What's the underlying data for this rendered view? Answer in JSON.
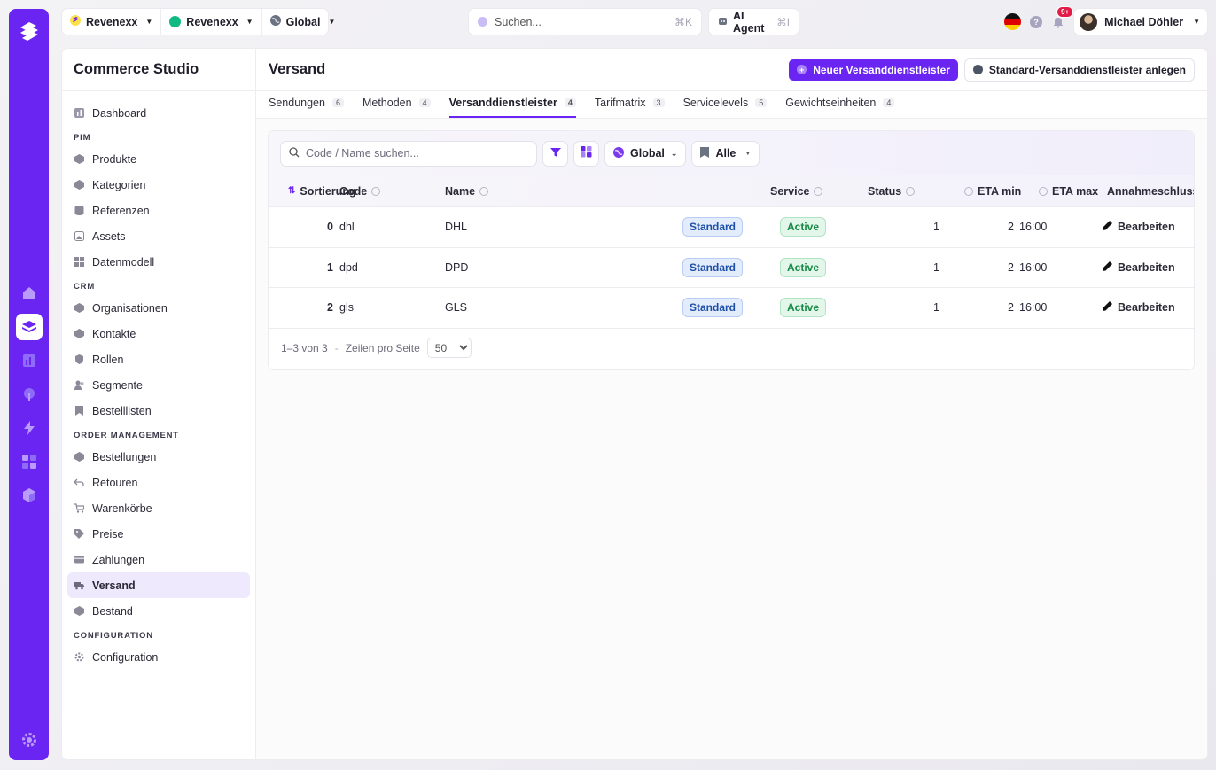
{
  "topbar": {
    "context": [
      {
        "label": "Revenexx",
        "icon": "revenexx-logo-icon"
      },
      {
        "label": "Revenexx",
        "icon": "green-dot-icon"
      },
      {
        "label": "Global",
        "icon": "globe-icon"
      }
    ],
    "search": {
      "placeholder": "Suchen...",
      "shortcut": "⌘K"
    },
    "agent": {
      "label": "AI Agent",
      "shortcut": "⌘I"
    },
    "notifications_badge": "9+",
    "user_name": "Michael Döhler"
  },
  "sidebar": {
    "app_title": "Commerce Studio",
    "top_items": [
      {
        "label": "Dashboard"
      }
    ],
    "sections": [
      {
        "title": "PIM",
        "items": [
          {
            "label": "Produkte"
          },
          {
            "label": "Kategorien"
          },
          {
            "label": "Referenzen"
          },
          {
            "label": "Assets"
          },
          {
            "label": "Datenmodell"
          }
        ]
      },
      {
        "title": "CRM",
        "items": [
          {
            "label": "Organisationen"
          },
          {
            "label": "Kontakte"
          },
          {
            "label": "Rollen"
          },
          {
            "label": "Segmente"
          },
          {
            "label": "Bestelllisten"
          }
        ]
      },
      {
        "title": "ORDER MANAGEMENT",
        "items": [
          {
            "label": "Bestellungen"
          },
          {
            "label": "Retouren"
          },
          {
            "label": "Warenkörbe"
          },
          {
            "label": "Preise"
          },
          {
            "label": "Zahlungen"
          },
          {
            "label": "Versand"
          },
          {
            "label": "Bestand"
          }
        ]
      },
      {
        "title": "CONFIGURATION",
        "items": [
          {
            "label": "Configuration"
          }
        ]
      }
    ],
    "active": "Versand"
  },
  "page": {
    "title": "Versand",
    "primary_button": "Neuer Versanddienstleister",
    "secondary_button": "Standard-Versanddienstleister anlegen",
    "tabs": [
      {
        "label": "Sendungen",
        "count": "6"
      },
      {
        "label": "Methoden",
        "count": "4"
      },
      {
        "label": "Versanddienstleister",
        "count": "4",
        "active": true
      },
      {
        "label": "Tarifmatrix",
        "count": "3"
      },
      {
        "label": "Servicelevels",
        "count": "5"
      },
      {
        "label": "Gewichtseinheiten",
        "count": "4"
      }
    ]
  },
  "toolbar": {
    "search_placeholder": "Code / Name suchen...",
    "scope": "Global",
    "filter": "Alle"
  },
  "table": {
    "headers": {
      "sort": "Sortierung",
      "code": "Code",
      "name": "Name",
      "service": "Service",
      "status": "Status",
      "eta_min": "ETA min",
      "eta_max": "ETA max",
      "cutoff": "Annahmeschluss"
    },
    "rows": [
      {
        "sort": "0",
        "code": "dhl",
        "name": "DHL",
        "service": "Standard",
        "status": "Active",
        "eta_min": "1",
        "eta_max": "2",
        "cutoff": "16:00",
        "action": "Bearbeiten"
      },
      {
        "sort": "1",
        "code": "dpd",
        "name": "DPD",
        "service": "Standard",
        "status": "Active",
        "eta_min": "1",
        "eta_max": "2",
        "cutoff": "16:00",
        "action": "Bearbeiten"
      },
      {
        "sort": "2",
        "code": "gls",
        "name": "GLS",
        "service": "Standard",
        "status": "Active",
        "eta_min": "1",
        "eta_max": "2",
        "cutoff": "16:00",
        "action": "Bearbeiten"
      }
    ]
  },
  "pagination": {
    "range": "1–3 von 3",
    "separator": "-",
    "rows_per_page_label": "Zeilen pro Seite",
    "rows_per_page": "50"
  },
  "colors": {
    "accent": "#6a25f2",
    "standard_badge": "#1d4fa8",
    "active_badge": "#168a46",
    "notification": "#e11d48"
  }
}
